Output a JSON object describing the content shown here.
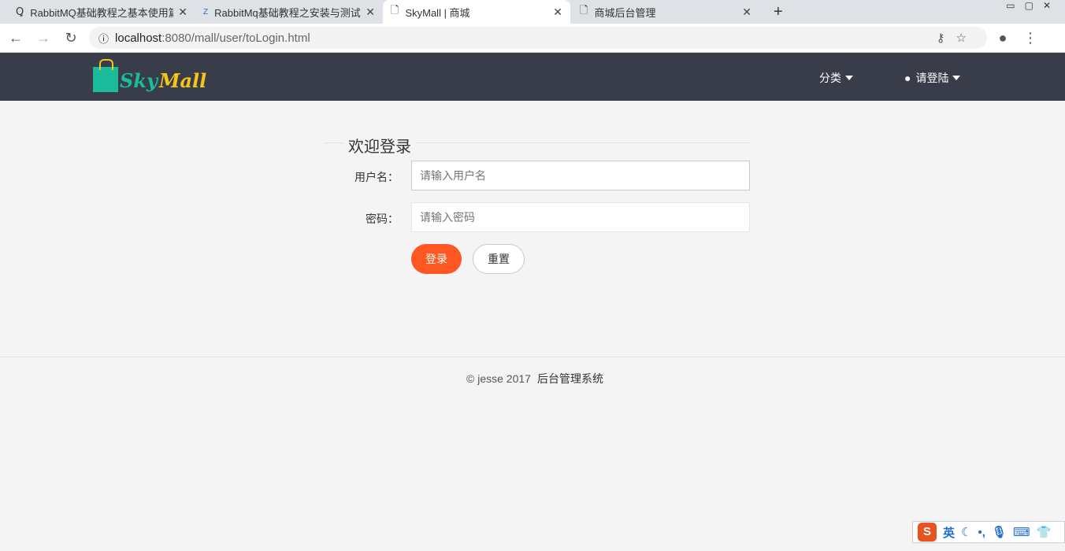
{
  "browser": {
    "tabs": [
      {
        "title": "RabbitMQ基础教程之基本使用篇"
      },
      {
        "title": "RabbitMq基础教程之安装与测试"
      },
      {
        "title": "SkyMall | 商城"
      },
      {
        "title": "商城后台管理"
      }
    ],
    "url_host": "localhost",
    "url_rest": ":8080/mall/user/toLogin.html"
  },
  "header": {
    "logo_sky": "Sky",
    "logo_mall": "Mall",
    "category": "分类",
    "login": "请登陆"
  },
  "form": {
    "title": "欢迎登录",
    "username_label": "用户名：",
    "username_placeholder": "请输入用户名",
    "password_label": "密码：",
    "password_placeholder": "请输入密码",
    "login_button": "登录",
    "reset_button": "重置"
  },
  "footer": {
    "copyright": "© jesse 2017",
    "admin_link": "后台管理系统"
  },
  "ime": {
    "logo": "S",
    "lang": "英"
  },
  "colors": {
    "header": "#393d49",
    "primary": "#ff5722"
  }
}
